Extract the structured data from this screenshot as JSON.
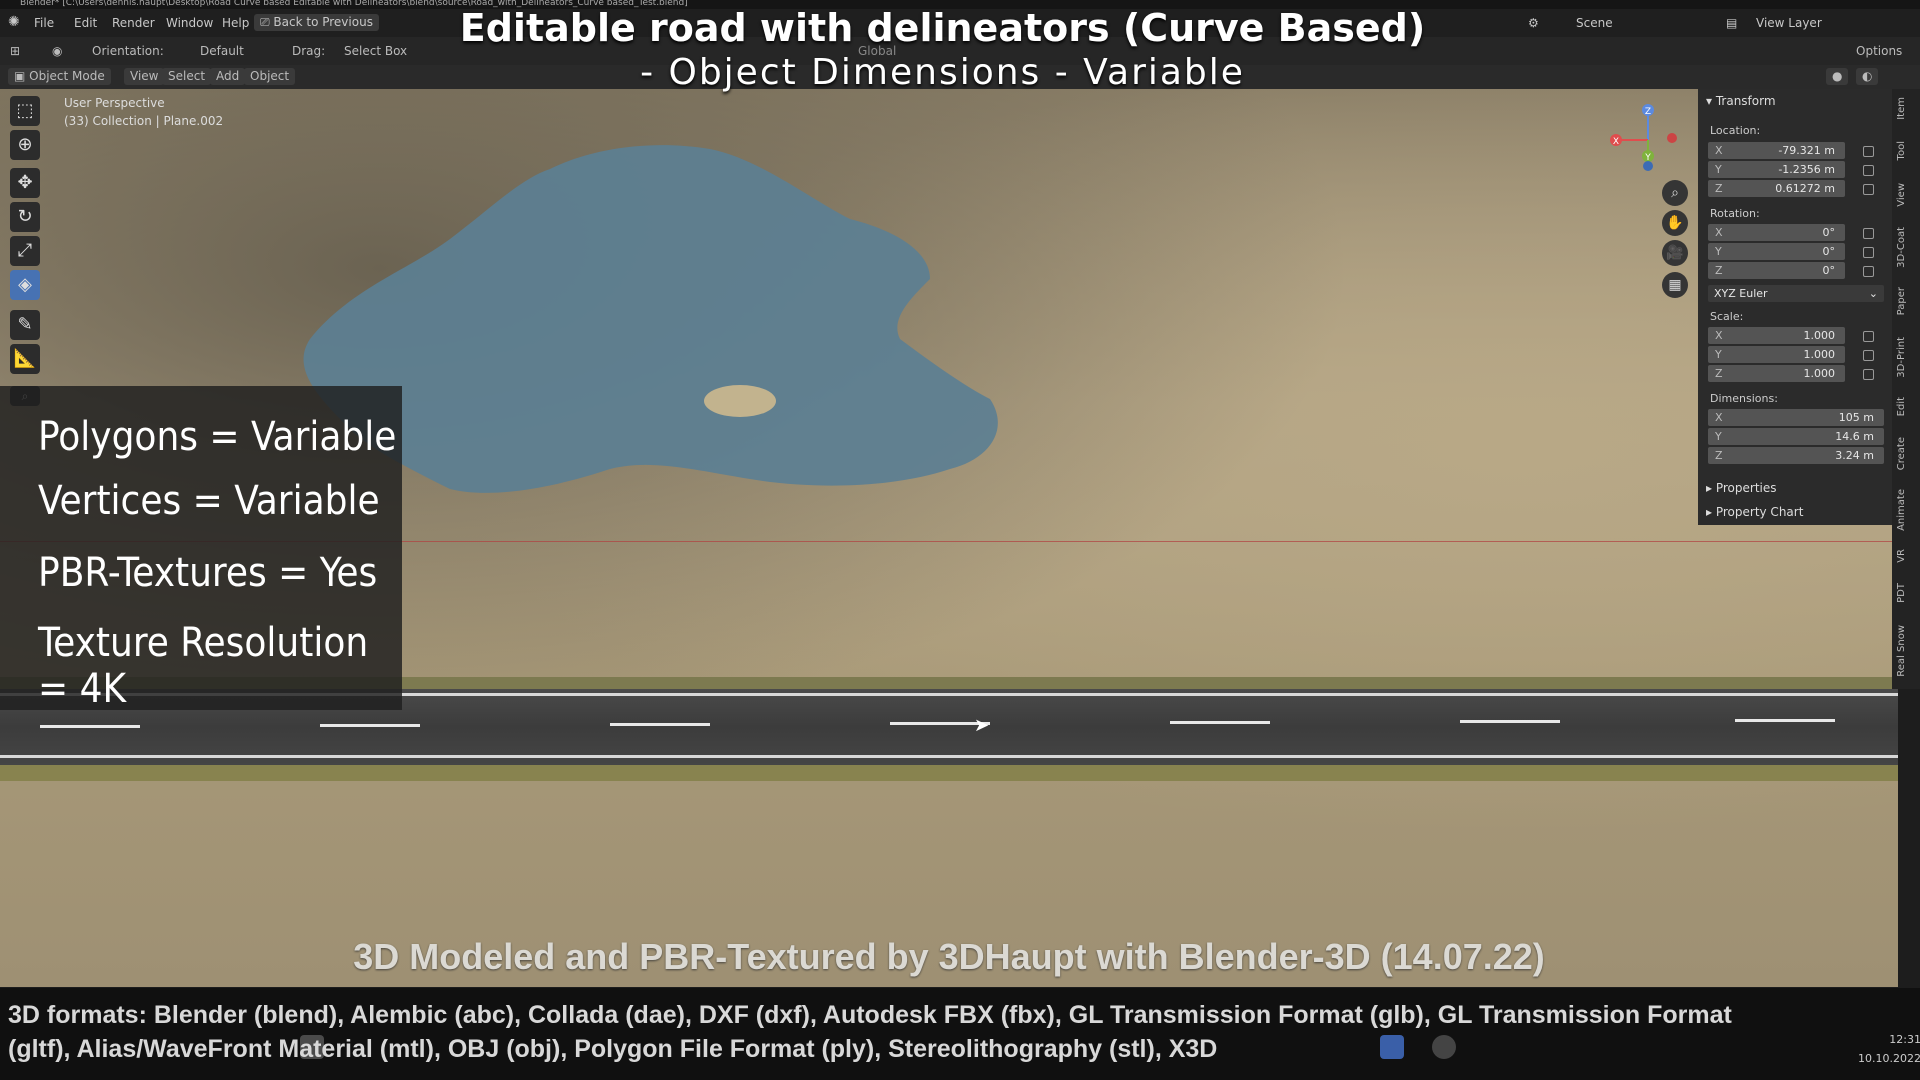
{
  "window": {
    "title": "Blender* [C:\\Users\\dennis.haupt\\Desktop\\Road Curve based Editable with Delineators\\blend\\source\\Road_with_Delineators_Curve based_Test.blend]"
  },
  "menu": {
    "items": [
      "File",
      "Edit",
      "Render",
      "Window",
      "Help"
    ],
    "back_label": "Back to Previous",
    "scene": "Scene",
    "view_layer": "View Layer"
  },
  "tool_header": {
    "orientation_label": "Orientation:",
    "orientation_value": "Default",
    "drag_label": "Drag:",
    "drag_value": "Select Box",
    "transform_orientation": "Global",
    "options_label": "Options"
  },
  "viewport_header": {
    "mode": "Object Mode",
    "menus": [
      "View",
      "Select",
      "Add",
      "Object"
    ]
  },
  "viewport": {
    "perspective": "User Perspective",
    "collection": "(33) Collection | Plane.002"
  },
  "overlay": {
    "title": "Editable road with delineators (Curve Based)",
    "subtitle": "- Object Dimensions -  Variable",
    "stats": [
      "Polygons = Variable",
      "Vertices = Variable",
      "PBR-Textures =  Yes",
      "Texture Resolution = 4K"
    ],
    "credits": "3D Modeled and PBR-Textured by 3DHaupt with Blender-3D (14.07.22)",
    "formats_line1": "3D formats: Blender (blend), Alembic (abc), Collada (dae), DXF (dxf), Autodesk FBX (fbx), GL Transmission Format (glb), GL Transmission Format",
    "formats_line2": "(gltf), Alias/WaveFront Material (mtl), OBJ (obj), Polygon File Format (ply), Stereolithography (stl), X3D"
  },
  "transform_panel": {
    "title": "Transform",
    "location_label": "Location:",
    "location": [
      {
        "axis": "X",
        "value": "-79.321 m"
      },
      {
        "axis": "Y",
        "value": "-1.2356 m"
      },
      {
        "axis": "Z",
        "value": "0.61272 m"
      }
    ],
    "rotation_label": "Rotation:",
    "rotation": [
      {
        "axis": "X",
        "value": "0°"
      },
      {
        "axis": "Y",
        "value": "0°"
      },
      {
        "axis": "Z",
        "value": "0°"
      }
    ],
    "rotation_mode": "XYZ Euler",
    "scale_label": "Scale:",
    "scale": [
      {
        "axis": "X",
        "value": "1.000"
      },
      {
        "axis": "Y",
        "value": "1.000"
      },
      {
        "axis": "Z",
        "value": "1.000"
      }
    ],
    "dimensions_label": "Dimensions:",
    "dimensions": [
      {
        "axis": "X",
        "value": "105 m"
      },
      {
        "axis": "Y",
        "value": "14.6 m"
      },
      {
        "axis": "Z",
        "value": "3.24 m"
      }
    ],
    "properties_label": "Properties",
    "property_chart_label": "Property Chart"
  },
  "side_tabs": [
    "Item",
    "Tool",
    "View",
    "3D-Coat",
    "Paper",
    "3D-Print",
    "Edit",
    "Create",
    "Animate",
    "VR",
    "PDT",
    "Real Snow"
  ],
  "gizmo": {
    "x": "X",
    "y": "Y",
    "z": "Z"
  },
  "clock": {
    "time": "12:31",
    "date": "10.10.2022"
  },
  "colors": {
    "accent": "#4772b3",
    "road": "#444444",
    "lake": "#5c7f93",
    "panel": "#2b2b2b"
  }
}
